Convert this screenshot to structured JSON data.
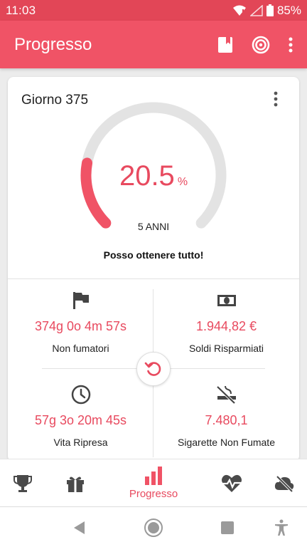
{
  "status_bar": {
    "time": "11:03",
    "battery": "85%"
  },
  "app_bar": {
    "title": "Progresso"
  },
  "card": {
    "title": "Giorno 375",
    "progress_percent": 20.5,
    "percent_value": "20.5",
    "percent_unit": "%",
    "goal_label": "5 ANNI",
    "motto": "Posso ottenere tutto!"
  },
  "stats": [
    {
      "icon": "flag-icon",
      "value": "374g 0o 4m 57s",
      "label": "Non fumatori"
    },
    {
      "icon": "money-icon",
      "value": "1.944,82 €",
      "label": "Soldi Risparmiati"
    },
    {
      "icon": "clock-icon",
      "value": "57g 3o 20m 45s",
      "label": "Vita Ripresa"
    },
    {
      "icon": "no-smoking-icon",
      "value": "7.480,1",
      "label": "Sigarette Non Fumate"
    }
  ],
  "bottom_nav": {
    "items": [
      {
        "icon": "trophy-icon"
      },
      {
        "icon": "gift-icon"
      },
      {
        "icon": "bar-chart-icon",
        "label": "Progresso",
        "active": true
      },
      {
        "icon": "heartbeat-icon"
      },
      {
        "icon": "cloud-off-icon"
      }
    ]
  },
  "colors": {
    "accent": "#f05366",
    "accent_dark": "#e24657",
    "value_text": "#e84a5f",
    "gauge_track": "#e3e3e3"
  }
}
